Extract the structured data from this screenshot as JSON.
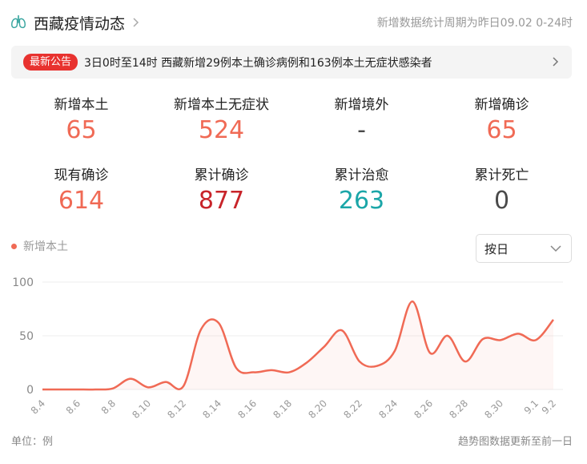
{
  "header": {
    "title": "西藏疫情动态",
    "period_note": "新增数据统计周期为昨日09.02 0-24时",
    "icon": "lungs-icon"
  },
  "notice": {
    "badge": "最新公告",
    "text": "3日0时至14时 西藏新增29例本土确诊病例和163例本土无症状感染者"
  },
  "stats": [
    {
      "label": "新增本土",
      "value": "65",
      "color": "#f06a55"
    },
    {
      "label": "新增本土无症状",
      "value": "524",
      "color": "#f06a55"
    },
    {
      "label": "新增境外",
      "value": "-",
      "color": "#4a4a4a"
    },
    {
      "label": "新增确诊",
      "value": "65",
      "color": "#f06a55"
    },
    {
      "label": "现有确诊",
      "value": "614",
      "color": "#f06a55"
    },
    {
      "label": "累计确诊",
      "value": "877",
      "color": "#c8242a"
    },
    {
      "label": "累计治愈",
      "value": "263",
      "color": "#1ba6a8"
    },
    {
      "label": "累计死亡",
      "value": "0",
      "color": "#4a4a4a"
    }
  ],
  "select": {
    "value": "按日"
  },
  "chart_data": {
    "type": "line",
    "x": [
      "8.4",
      "8.5",
      "8.6",
      "8.7",
      "8.8",
      "8.9",
      "8.10",
      "8.11",
      "8.12",
      "8.13",
      "8.14",
      "8.15",
      "8.16",
      "8.17",
      "8.18",
      "8.19",
      "8.20",
      "8.21",
      "8.22",
      "8.23",
      "8.24",
      "8.25",
      "8.26",
      "8.27",
      "8.28",
      "8.29",
      "8.30",
      "8.31",
      "9.1",
      "9.2"
    ],
    "x_tick_labels": [
      "8.4",
      "8.6",
      "8.8",
      "8.10",
      "8.12",
      "8.14",
      "8.16",
      "8.18",
      "8.20",
      "8.22",
      "8.24",
      "8.26",
      "8.28",
      "8.30",
      "9.1",
      "9.2"
    ],
    "series": [
      {
        "name": "新增本土",
        "color": "#f06a55",
        "values": [
          0,
          0,
          0,
          0,
          1,
          10,
          2,
          7,
          3,
          56,
          62,
          20,
          16,
          18,
          16,
          25,
          40,
          55,
          26,
          22,
          36,
          82,
          34,
          50,
          26,
          47,
          46,
          52,
          46,
          65
        ]
      }
    ],
    "ylim": [
      0,
      100
    ],
    "y_ticks": [
      0,
      50,
      100
    ],
    "grid": true
  },
  "footer": {
    "unit": "单位：例",
    "note": "趋势图数据更新至前一日"
  }
}
